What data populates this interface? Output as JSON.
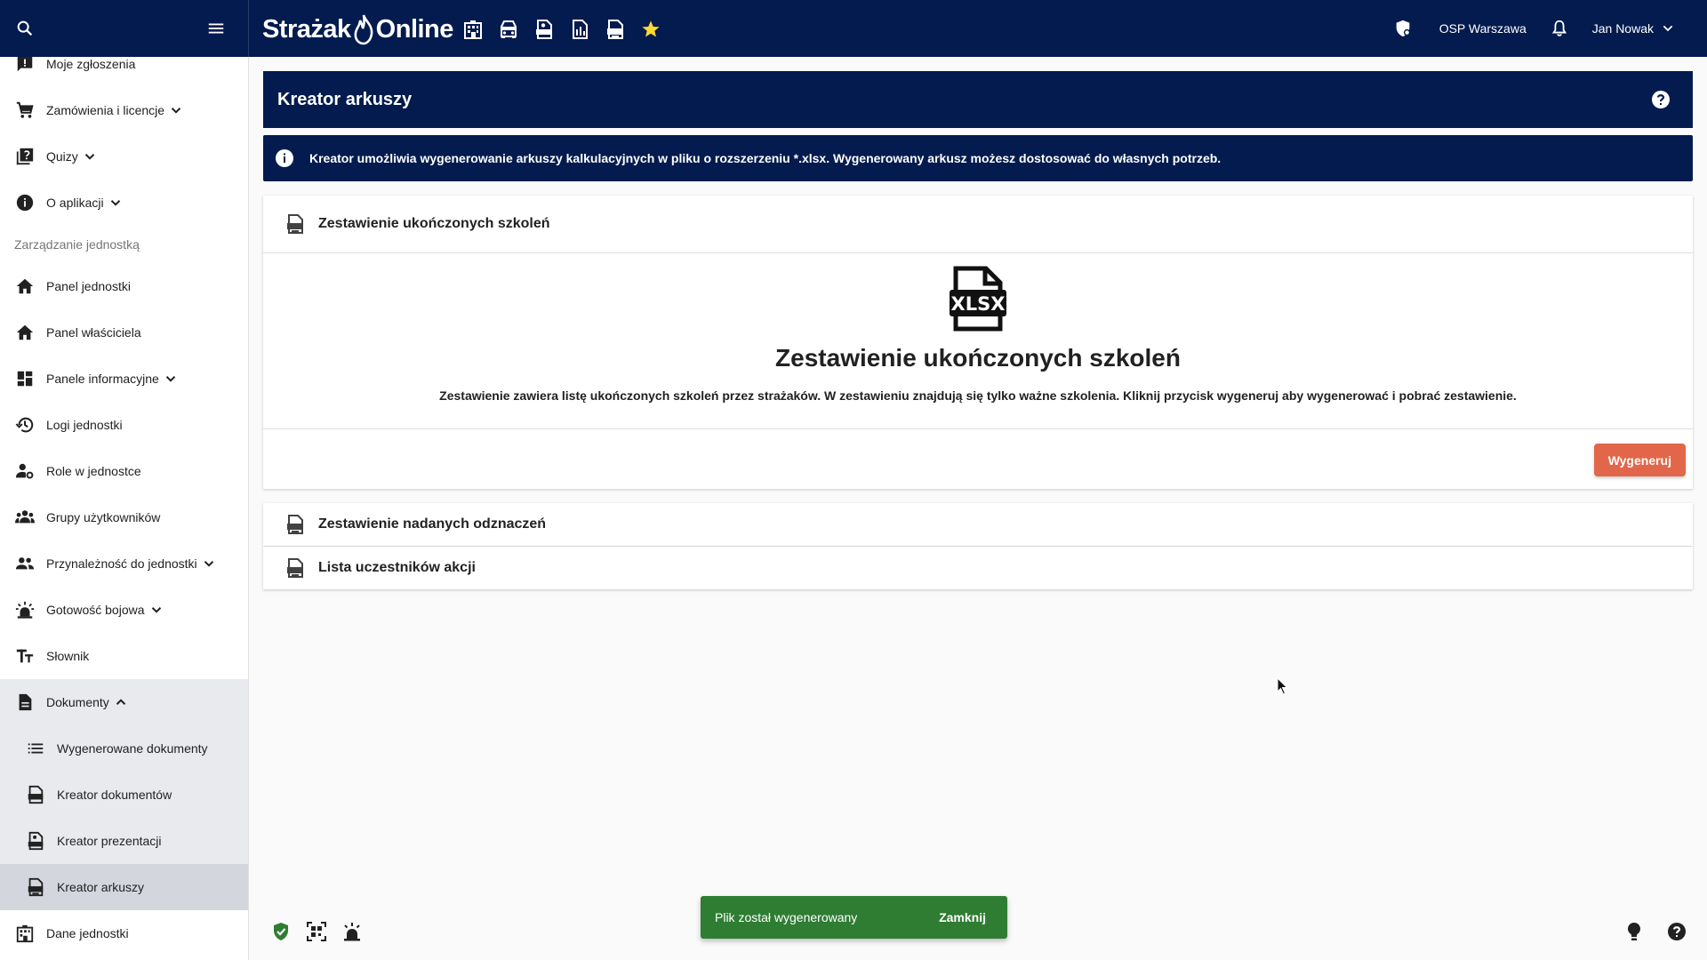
{
  "app": {
    "brand_left": "Strażak",
    "brand_right": "Online",
    "brand_icons": [
      "building-icon",
      "firetruck-icon",
      "pptx-file-icon",
      "inventory-icon",
      "xlsx-file-icon",
      "star-icon"
    ],
    "unit_name": "OSP Warszawa",
    "user_name": "Jan Nowak",
    "accent": "#031b4e",
    "brand_star_color": "#fdd835"
  },
  "sidebar": {
    "items_top": [
      {
        "label": "Moje zgłoszenia",
        "icon": "feedback-icon",
        "chevron": false
      },
      {
        "label": "Zamówienia i licencje",
        "icon": "cart-icon",
        "chevron": true
      },
      {
        "label": "Quizy",
        "icon": "quiz-icon",
        "chevron": true
      },
      {
        "label": "O aplikacji",
        "icon": "info-icon",
        "chevron": true
      }
    ],
    "section_label": "Zarządzanie jednostką",
    "items_unit": [
      {
        "label": "Panel jednostki",
        "icon": "home-icon",
        "chevron": false
      },
      {
        "label": "Panel właściciela",
        "icon": "home-icon",
        "chevron": false
      },
      {
        "label": "Panele informacyjne",
        "icon": "dashboard-icon",
        "chevron": true
      },
      {
        "label": "Logi jednostki",
        "icon": "history-icon",
        "chevron": false
      },
      {
        "label": "Role w jednostce",
        "icon": "person-settings-icon",
        "chevron": false
      },
      {
        "label": "Grupy użytkowników",
        "icon": "groups-icon",
        "chevron": false
      },
      {
        "label": "Przynależność do jednostki",
        "icon": "people-icon",
        "chevron": true
      },
      {
        "label": "Gotowość bojowa",
        "icon": "alarm-light-icon",
        "chevron": true
      },
      {
        "label": "Słownik",
        "icon": "text-fields-icon",
        "chevron": false
      }
    ],
    "documents": {
      "label": "Dokumenty",
      "icon": "document-icon",
      "children": [
        {
          "label": "Wygenerowane dokumenty",
          "icon": "list-icon"
        },
        {
          "label": "Kreator dokumentów",
          "icon": "docx-file-icon"
        },
        {
          "label": "Kreator prezentacji",
          "icon": "pptx-file-icon"
        },
        {
          "label": "Kreator arkuszy",
          "icon": "xlsx-file-icon",
          "active": true
        }
      ]
    },
    "items_bottom": [
      {
        "label": "Dane jednostki",
        "icon": "building-icon",
        "chevron": false
      }
    ]
  },
  "page": {
    "title": "Kreator arkuszy",
    "info": "Kreator umożliwia wygenerowanie arkuszy kalkulacyjnych w pliku o rozszerzeniu *.xlsx. Wygenerowany arkusz możesz dostosować do własnych potrzeb."
  },
  "cards": [
    {
      "title": "Zestawienie ukończonych szkoleń",
      "expanded": true,
      "body_title": "Zestawienie ukończonych szkoleń",
      "description": "Zestawienie zawiera listę ukończonych szkoleń przez strażaków. W zestawieniu znajdują się tylko ważne szkolenia. Kliknij przycisk wygeneruj aby wygenerować i pobrać zestawienie.",
      "big_icon_label": "XLSX",
      "action_label": "Wygeneruj"
    },
    {
      "title": "Zestawienie nadanych odznaczeń",
      "expanded": false
    },
    {
      "title": "Lista uczestników akcji",
      "expanded": false
    }
  ],
  "snackbar": {
    "message": "Plik został wygenerowany",
    "action": "Zamknij",
    "color": "#2e7d32"
  }
}
